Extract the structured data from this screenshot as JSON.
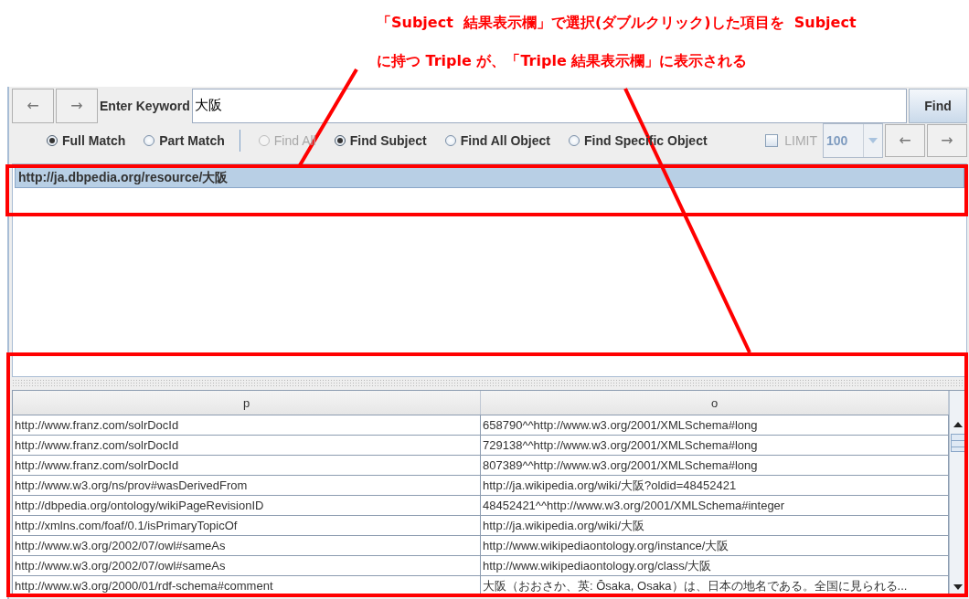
{
  "caption": {
    "lines": [
      "「Subject  結果表示欄」で選択(ダブルクリック)した項目を  Subject",
      "に持つ Triple が、「Triple 結果表示欄」に表示される"
    ]
  },
  "toolbar": {
    "back": "←",
    "forward": "→",
    "keyword_label": "Enter Keyword",
    "keyword_value": "大阪",
    "find_button": "Find"
  },
  "match_options": [
    {
      "label": "Full Match",
      "selected": true,
      "disabled": false
    },
    {
      "label": "Part Match",
      "selected": false,
      "disabled": false
    }
  ],
  "find_options": [
    {
      "label": "Find All",
      "selected": false,
      "disabled": true
    },
    {
      "label": "Find Subject",
      "selected": true,
      "disabled": false
    },
    {
      "label": "Find All Object",
      "selected": false,
      "disabled": false
    },
    {
      "label": "Find Specific Object",
      "selected": false,
      "disabled": false
    }
  ],
  "limit": {
    "label": "LIMIT",
    "checked": false,
    "disabled": true,
    "value": "100",
    "prev": "←",
    "next": "→"
  },
  "subject_results": [
    {
      "text": "http://ja.dbpedia.org/resource/大阪",
      "selected": true
    }
  ],
  "triple_table": {
    "columns": [
      "p",
      "o"
    ],
    "rows": [
      [
        "http://www.franz.com/solrDocId",
        "658790^^http://www.w3.org/2001/XMLSchema#long"
      ],
      [
        "http://www.franz.com/solrDocId",
        "729138^^http://www.w3.org/2001/XMLSchema#long"
      ],
      [
        "http://www.franz.com/solrDocId",
        "807389^^http://www.w3.org/2001/XMLSchema#long"
      ],
      [
        "http://www.w3.org/ns/prov#wasDerivedFrom",
        "http://ja.wikipedia.org/wiki/大阪?oldid=48452421"
      ],
      [
        "http://dbpedia.org/ontology/wikiPageRevisionID",
        "48452421^^http://www.w3.org/2001/XMLSchema#integer"
      ],
      [
        "http://xmlns.com/foaf/0.1/isPrimaryTopicOf",
        "http://ja.wikipedia.org/wiki/大阪"
      ],
      [
        "http://www.w3.org/2002/07/owl#sameAs",
        "http://www.wikipediaontology.org/instance/大阪"
      ],
      [
        "http://www.w3.org/2002/07/owl#sameAs",
        "http://www.wikipediaontology.org/class/大阪"
      ],
      [
        "http://www.w3.org/2000/01/rdf-schema#comment",
        "大阪（おおさか、英: Ōsaka, Osaka）は、日本の地名である。全国に見られる..."
      ]
    ]
  }
}
